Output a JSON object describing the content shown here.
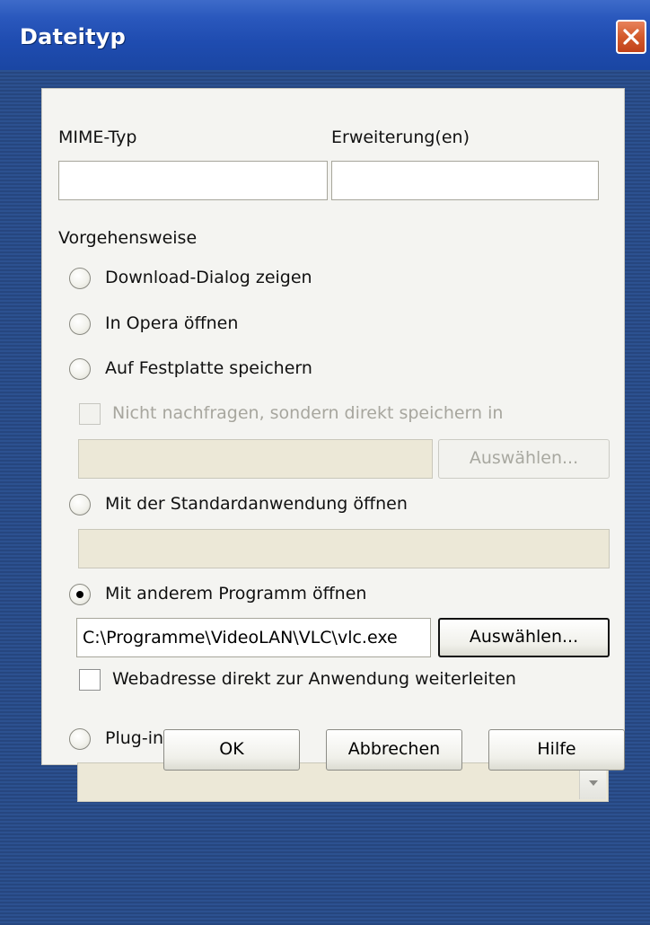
{
  "window": {
    "title": "Dateityp"
  },
  "icons": {
    "close": "close-icon",
    "dropdown": "chevron-down-icon"
  },
  "fields": {
    "mime_label": "MIME-Typ",
    "mime_value": "",
    "ext_label": "Erweiterung(en)",
    "ext_value": ""
  },
  "section": {
    "label": "Vorgehensweise"
  },
  "options": {
    "download_dialog": "Download-Dialog zeigen",
    "open_in_opera": "In Opera öffnen",
    "save_to_disk": "Auf Festplatte speichern",
    "save_direct_checkbox": "Nicht nachfragen, sondern direkt speichern in",
    "save_path": "",
    "save_choose_button": "Auswählen...",
    "default_app": "Mit der Standardanwendung öffnen",
    "default_app_path": "",
    "other_program": "Mit anderem Programm öffnen",
    "other_program_path": "C:\\Programme\\VideoLAN\\VLC\\vlc.exe",
    "other_program_choose_button": "Auswählen...",
    "pass_url_checkbox": "Webadresse direkt zur Anwendung weiterleiten",
    "plugin": "Plug-in verwenden",
    "plugin_select_value": ""
  },
  "selected_option": "other_program",
  "buttons": {
    "ok": "OK",
    "cancel": "Abbrechen",
    "help": "Hilfe"
  }
}
